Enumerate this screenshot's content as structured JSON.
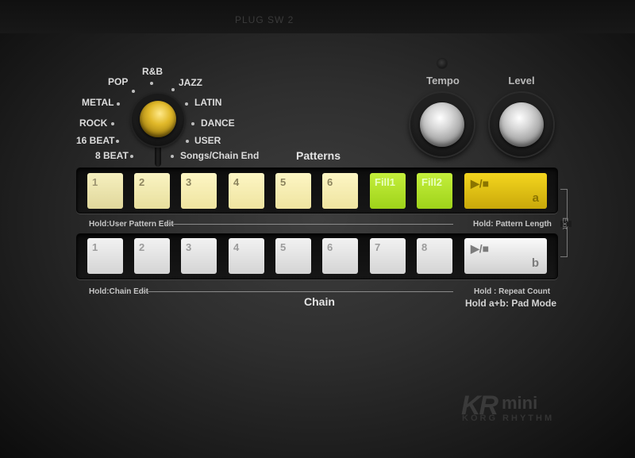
{
  "top_text": "PLUG SW   2",
  "genre_selector": {
    "labels": [
      "POP",
      "R&B",
      "JAZZ",
      "METAL",
      "LATIN",
      "ROCK",
      "DANCE",
      "16 BEAT",
      "USER",
      "8 BEAT",
      "Songs/Chain End"
    ]
  },
  "knobs": {
    "tempo_label": "Tempo",
    "level_label": "Level"
  },
  "patterns": {
    "title": "Patterns",
    "pads": [
      "1",
      "2",
      "3",
      "4",
      "5",
      "6",
      "Fill1",
      "Fill2"
    ],
    "play_symbol": "▶/■",
    "play_letter": "a",
    "hint_left": "Hold:User Pattern Edit",
    "hint_right": "Hold: Pattern Length"
  },
  "chain": {
    "title": "Chain",
    "pads": [
      "1",
      "2",
      "3",
      "4",
      "5",
      "6",
      "7",
      "8"
    ],
    "play_symbol": "▶/■",
    "play_letter": "b",
    "hint_left": "Hold:Chain Edit",
    "hint_right": "Hold : Repeat Count",
    "hint_right2": "Hold a+b: Pad Mode"
  },
  "exit_label": "Exit",
  "logo": {
    "main": "KR",
    "mini": "mini",
    "sub": "KORG RHYTHM"
  },
  "colors": {
    "genre_knob": "#e1b92a",
    "pattern_pad": "#f6f0bf",
    "fill_pad": "#b3e12a",
    "play_a": "#f4d51e",
    "chain_pad": "#e6e6e6"
  }
}
